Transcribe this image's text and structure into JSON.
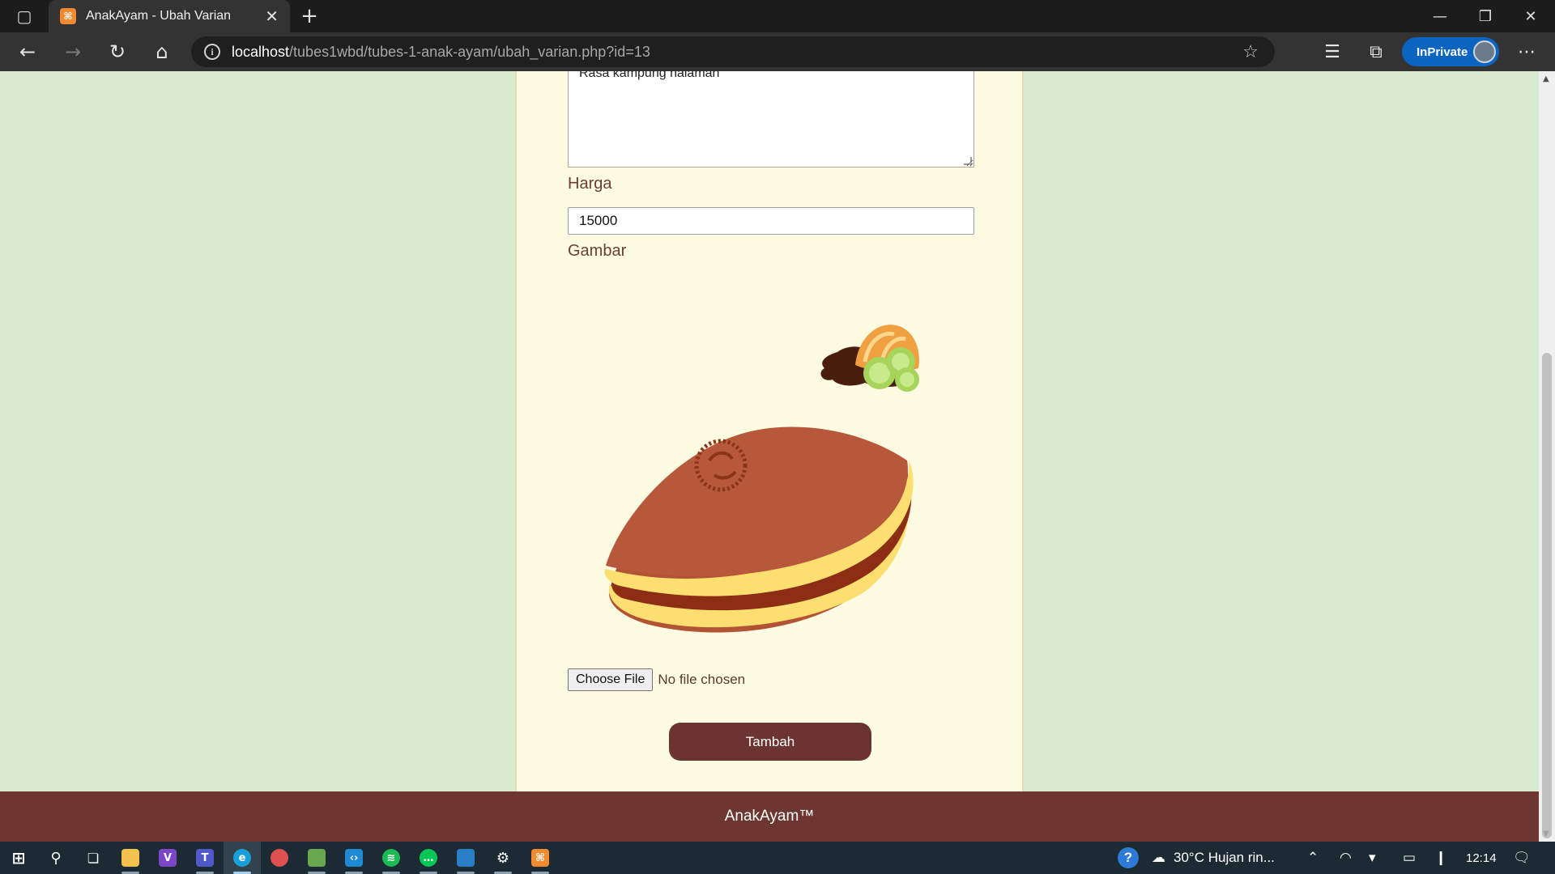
{
  "browser": {
    "tab_title": "AnakAyam - Ubah Varian",
    "favicon_text": "⌘",
    "url_host": "localhost",
    "url_path": "/tubes1wbd/tubes-1-anak-ayam/ubah_varian.php?id=13",
    "inprivate_label": "InPrivate"
  },
  "form": {
    "deskripsi_value": "Rasa kampung halaman",
    "harga_label": "Harga",
    "harga_value": "15000",
    "gambar_label": "Gambar",
    "file_button": "Choose File",
    "file_status": "No file chosen",
    "submit_label": "Tambah"
  },
  "footer": {
    "text": "AnakAyam™"
  },
  "taskbar": {
    "weather": "30°C  Hujan rin...",
    "time": "12:14"
  },
  "colors": {
    "page_bg": "#d9ead0",
    "card_bg": "#fefbe3",
    "brand_brown": "#6d3630",
    "label_brown": "#6b4030"
  }
}
